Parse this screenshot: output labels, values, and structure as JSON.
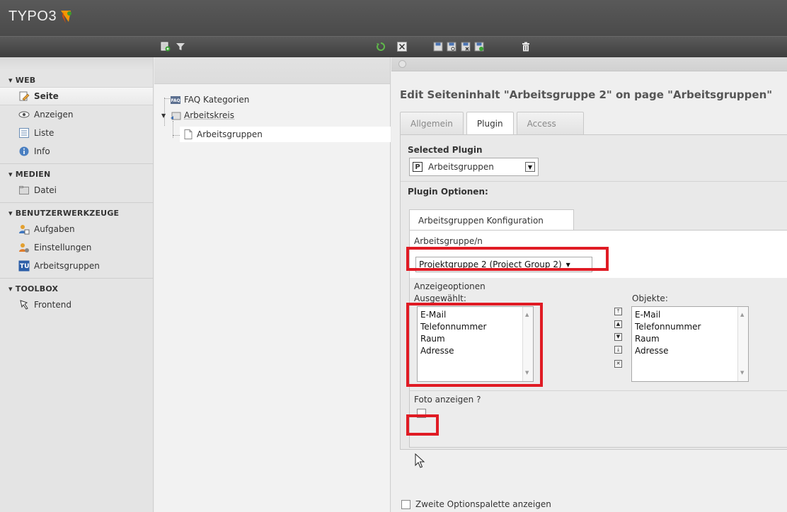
{
  "app": {
    "logo_text": "TYPO3"
  },
  "module_menu": {
    "sections": [
      {
        "title": "▾ WEB",
        "items": [
          {
            "label": "Seite",
            "icon": "page-edit-icon",
            "active": true
          },
          {
            "label": "Anzeigen",
            "icon": "eye-icon"
          },
          {
            "label": "Liste",
            "icon": "list-icon"
          },
          {
            "label": "Info",
            "icon": "info-icon"
          }
        ]
      },
      {
        "title": "▾ MEDIEN",
        "items": [
          {
            "label": "Datei",
            "icon": "folder-icon"
          }
        ]
      },
      {
        "title": "▾ BENUTZERWERKZEUGE",
        "items": [
          {
            "label": "Aufgaben",
            "icon": "user-tasks-icon"
          },
          {
            "label": "Einstellungen",
            "icon": "user-settings-icon"
          },
          {
            "label": "Arbeitsgruppen",
            "icon": "tu-extension-icon"
          }
        ]
      },
      {
        "title": "▾ TOOLBOX",
        "items": [
          {
            "label": "Frontend",
            "icon": "frontend-icon"
          }
        ]
      }
    ]
  },
  "page_tree": {
    "nodes": [
      {
        "label": "FAQ Kategorien"
      },
      {
        "label": "Arbeitskreis"
      },
      {
        "label": "Arbeitsgruppen"
      }
    ]
  },
  "content": {
    "title": "Edit Seiteninhalt \"Arbeitsgruppe 2\" on page \"Arbeitsgruppen\"",
    "tabs": [
      "Allgemein",
      "Plugin",
      "Access"
    ],
    "active_tab": "Plugin",
    "selected_plugin_label": "Selected Plugin",
    "selected_plugin_value": "Arbeitsgruppen",
    "plugin_options_label": "Plugin Optionen:",
    "subtab_label": "Arbeitsgruppen Konfiguration",
    "group_label": "Arbeitsgruppe/n",
    "group_value": "Projektgruppe 2 (Project Group 2)",
    "display_options_label": "Anzeigeoptionen",
    "selected_label": "Ausgewählt:",
    "objects_label": "Objekte:",
    "selected_items": [
      "E-Mail",
      "Telefonnummer",
      "Raum",
      "Adresse"
    ],
    "object_items": [
      "E-Mail",
      "Telefonnummer",
      "Raum",
      "Adresse"
    ],
    "show_photo_label": "Foto anzeigen ?",
    "second_palette_label": "Zweite Optionspalette anzeigen"
  },
  "colors": {
    "highlight": "#e01b24",
    "topbar": "#4a4a4a",
    "logo_accent": "#f49700"
  }
}
